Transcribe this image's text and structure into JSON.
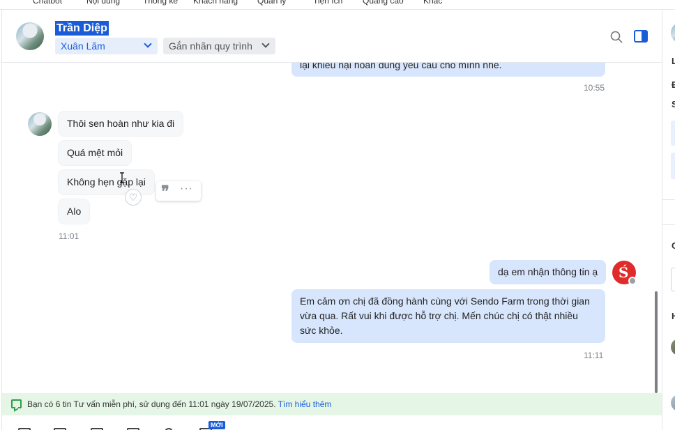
{
  "topnav": {
    "items": [
      "Chatbot",
      "Nội dung",
      "Thống kê",
      "Khách hàng",
      "Quản lý",
      "Tiện ích",
      "Quảng cáo",
      "Khác"
    ]
  },
  "header": {
    "contact_name": "Trần Diệp",
    "assignee": "Xuân Lãm",
    "tag_placeholder": "Gắn nhãn quy trình"
  },
  "messages": {
    "prev_out_text": "lại khiếu nại hoàn đúng yêu cầu cho mình nhé.",
    "prev_out_time": "10:55",
    "in_1": "Thôi sen hoàn như kia đi",
    "in_2": "Quá mệt mỏi",
    "in_3": "Không hẹn gặp lại",
    "in_4": "Alo",
    "in_time": "11:01",
    "out_1": "dạ em nhận thông tin ạ",
    "out_2": "Em cảm ơn chị đã đồng hành cùng với Sendo Farm trong thời gian vừa qua. Rất vui khi được hỗ trợ chị. Mến chúc chị có thật nhiều sức khỏe.",
    "out_time": "11:11"
  },
  "hover_tools": {
    "quote_glyph": "❞",
    "more_glyph": "···"
  },
  "reaction_glyph": "♡",
  "notice": {
    "text": "Bạn có 6 tin Tư vấn miễn phí, sử dụng đến 11:01 ngày 19/07/2025.",
    "link": "Tìm hiểu thêm"
  },
  "toolbar": {
    "new_badge": "MỚI"
  },
  "right_panel": {
    "letters": [
      "L",
      "Đ",
      "S",
      "C",
      "H"
    ]
  },
  "colors": {
    "accent": "#1a5cd8",
    "outgoing_bubble": "#d7e6fd",
    "notice_bg": "#e6f6e6",
    "sendo_red": "#e02b2b"
  }
}
